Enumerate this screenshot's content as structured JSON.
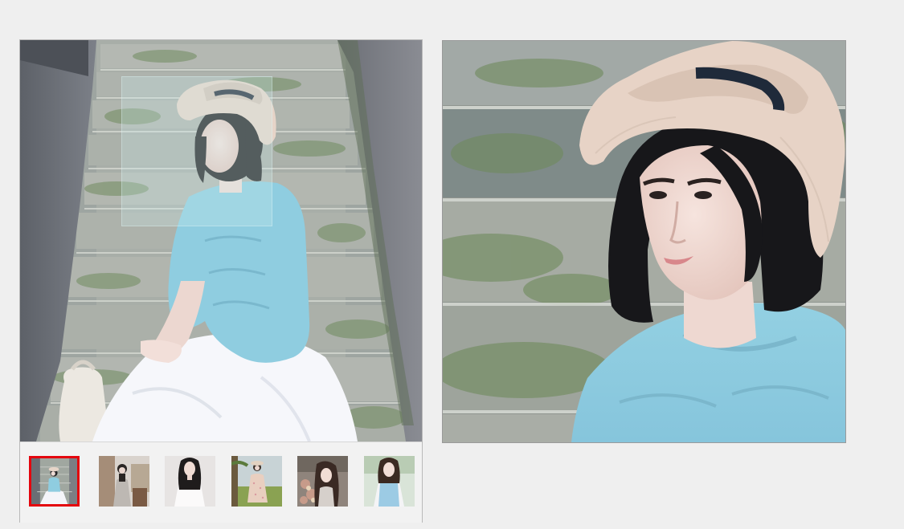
{
  "gallery": {
    "main_image": {
      "icon": "photo-girl-on-stairs",
      "colors": {
        "sweater": "#8fcde0",
        "skirt": "#f6f7fb",
        "hat": "#e6d4c8",
        "stairs": "#a3aaa2",
        "moss": "#6f8a5e"
      }
    },
    "zoom_lens": {
      "color": "#cdeeee"
    },
    "thumbnails": [
      {
        "icon": "photo-girl-stairs-thumb",
        "selected": true
      },
      {
        "icon": "photo-girl-room-thumb",
        "selected": false
      },
      {
        "icon": "photo-girl-white-dress-thumb",
        "selected": false
      },
      {
        "icon": "photo-girl-field-thumb",
        "selected": false
      },
      {
        "icon": "photo-girl-flowers-thumb",
        "selected": false
      },
      {
        "icon": "photo-girl-blue-dress-thumb",
        "selected": false
      }
    ],
    "selected_border_color": "#e4060e",
    "zoom_preview": {
      "icon": "photo-girl-closeup"
    }
  }
}
